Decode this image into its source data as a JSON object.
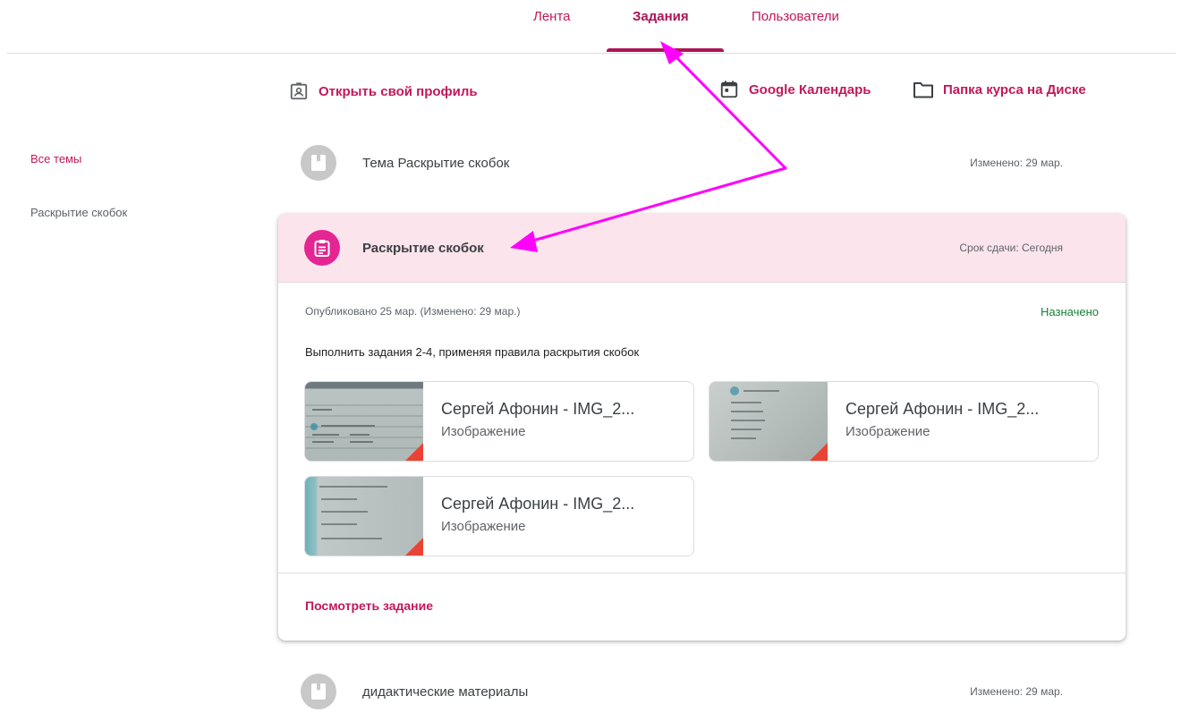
{
  "nav": {
    "tabs": [
      {
        "label": "Лента"
      },
      {
        "label": "Задания"
      },
      {
        "label": "Пользователи"
      }
    ]
  },
  "links": {
    "profile": "Открыть свой профиль",
    "calendar": "Google Календарь",
    "folder": "Папка курса на Диске"
  },
  "sidebar": {
    "items": [
      {
        "label": "Все темы"
      },
      {
        "label": "Раскрытие скобок"
      }
    ]
  },
  "topics": [
    {
      "title": "Тема Раскрытие скобок",
      "meta": "Изменено: 29 мар."
    },
    {
      "title": "дидактические материалы",
      "meta": "Изменено: 29 мар."
    }
  ],
  "assignment": {
    "title": "Раскрытие скобок",
    "due": "Срок сдачи: Сегодня",
    "published": "Опубликовано 25 мар. (Изменено: 29 мар.)",
    "status": "Назначено",
    "description": "Выполнить задания 2-4, применяя правила раскрытия скобок",
    "attachments": [
      {
        "title": "Сергей Афонин - IMG_2...",
        "type": "Изображение"
      },
      {
        "title": "Сергей Афонин - IMG_2...",
        "type": "Изображение"
      },
      {
        "title": "Сергей Афонин - IMG_2...",
        "type": "Изображение"
      }
    ],
    "view_label": "Посмотреть задание"
  },
  "colors": {
    "accent": "#c2185b",
    "header_bg": "#fce4ec",
    "assignment_icon": "#e52592",
    "status": "#188038",
    "arrow": "#ff00ff"
  }
}
